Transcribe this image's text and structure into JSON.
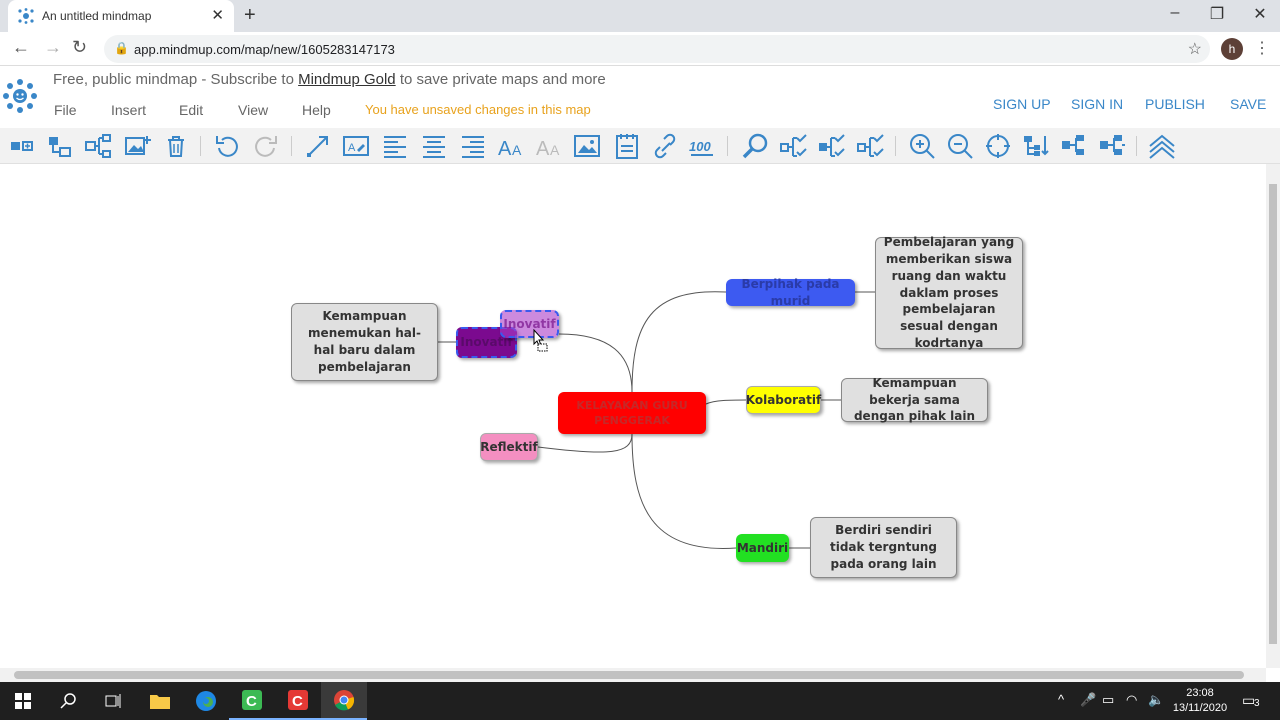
{
  "browser": {
    "tab_title": "An untitled mindmap",
    "url": "app.mindmup.com/map/new/1605283147173",
    "avatar_letter": "h"
  },
  "header": {
    "promo_prefix": "Free, public mindmap - Subscribe to ",
    "promo_link": "Mindmup Gold",
    "promo_suffix": " to save private maps and more",
    "menu": [
      "File",
      "Insert",
      "Edit",
      "View",
      "Help"
    ],
    "unsaved": "You have unsaved changes in this map",
    "buttons": [
      "SIGN UP",
      "SIGN IN",
      "PUBLISH",
      "SAVE"
    ]
  },
  "mindmap": {
    "root": "KELAYAKAN GURU PENGGERAK",
    "branches": {
      "berpihak": "Berpihak pada murid",
      "kolaboratif": "Kolaboratif",
      "mandiri": "Mandiri",
      "reflektif": "Reflektif",
      "inovatif": "Inovatif",
      "inovatif_drag": "Inovatif"
    },
    "descriptions": {
      "berpihak": "Pembelajaran yang memberikan siswa ruang dan waktu daklam proses pembelajaran sesual dengan kodrtanya",
      "kolaboratif": "Kemampuan bekerja sama dengan pihak lain",
      "mandiri": "Berdiri sendiri tidak tergntung pada orang lain",
      "inovatif": "Kemampuan menemukan hal-hal baru dalam pembelajaran"
    },
    "colors": {
      "root": "#ff0000",
      "berpihak": "#3d5af1",
      "kolaboratif": "#ffff00",
      "mandiri": "#22e022",
      "reflektif": "#f48fc1",
      "inovatif": "#7b0a8f",
      "description": "#e0e0e0"
    }
  },
  "taskbar": {
    "time": "23:08",
    "date": "13/11/2020",
    "notifications": "3"
  }
}
